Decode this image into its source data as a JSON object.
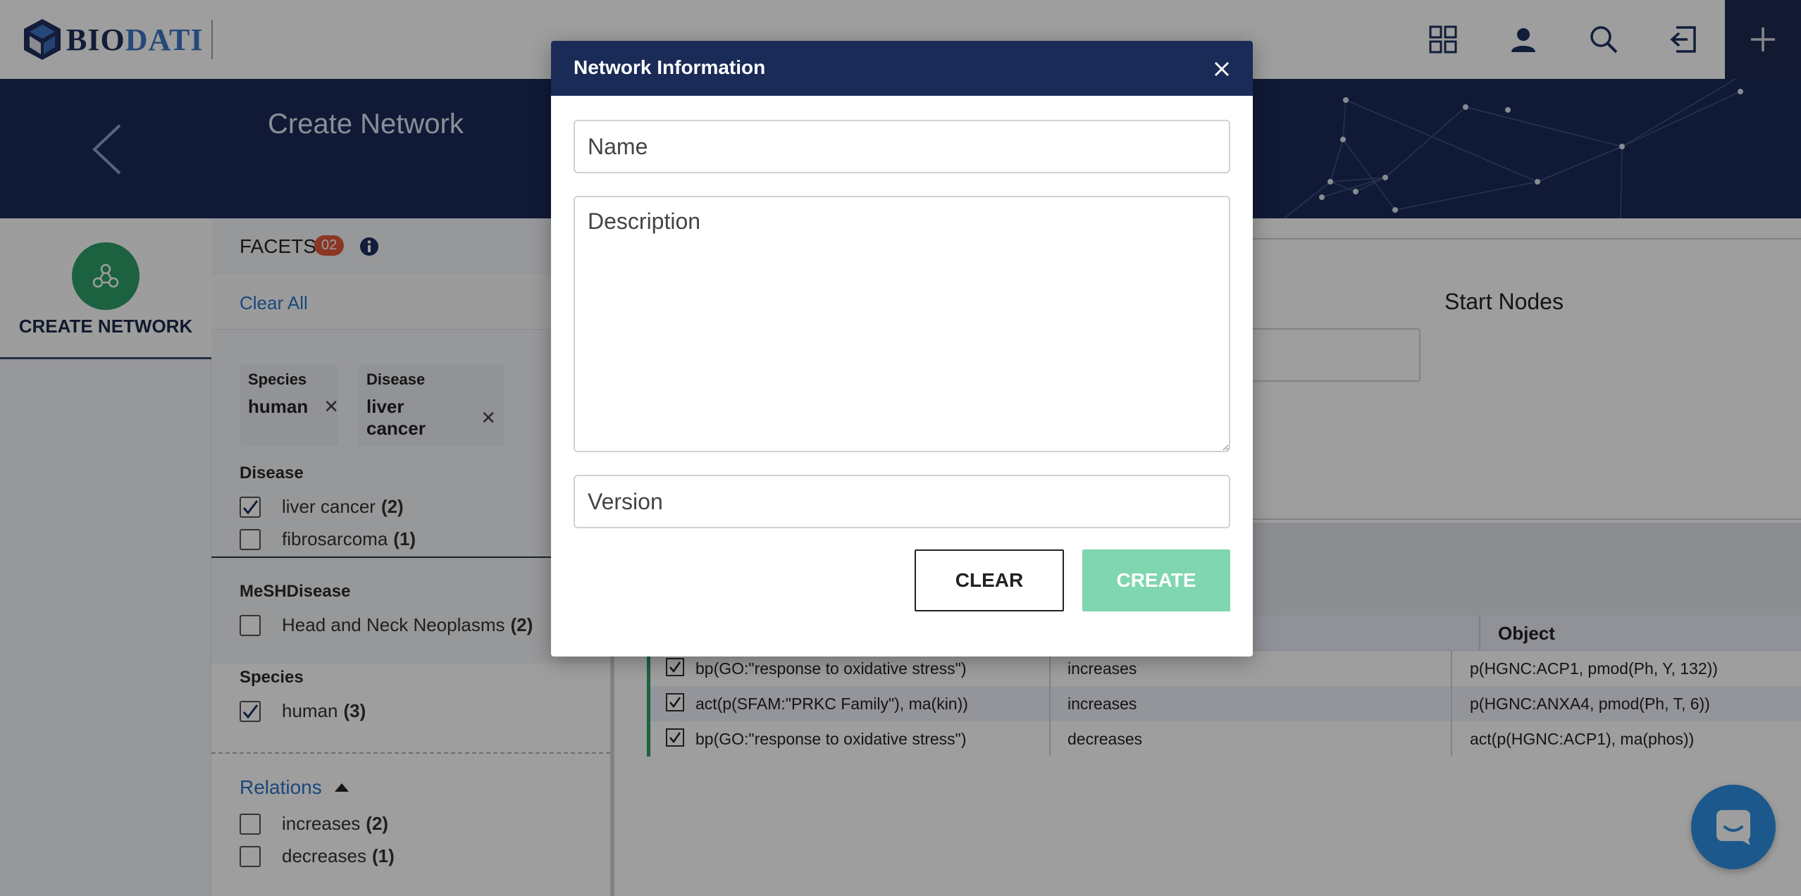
{
  "app": {
    "logo_text_1": "BIO",
    "logo_text_2": "DATI",
    "brand_colors": {
      "navy": "#1b2b57",
      "green": "#2e9d68",
      "blue": "#2a74c7"
    }
  },
  "topbar": {
    "icons": [
      "grid-icon",
      "user-icon",
      "search-icon",
      "logout-icon",
      "plus-icon"
    ]
  },
  "hero": {
    "title": "Create Network"
  },
  "leftnav": {
    "create_label": "CREATE NETWORK"
  },
  "facets": {
    "title": "FACETS",
    "badge": "02",
    "clear_all": "Clear All",
    "chips": [
      {
        "key": "Species",
        "value": "human"
      },
      {
        "key": "Disease",
        "value": "liver cancer"
      }
    ],
    "groups": [
      {
        "title": "Disease",
        "items": [
          {
            "label": "liver cancer",
            "count": "(2)",
            "checked": true
          },
          {
            "label": "fibrosarcoma",
            "count": "(1)",
            "checked": false
          }
        ]
      },
      {
        "title": "MeSHDisease",
        "items": [
          {
            "label": "Head and Neck Neoplasms",
            "count": "(2)",
            "checked": false
          }
        ]
      },
      {
        "title": "Species",
        "items": [
          {
            "label": "human",
            "count": "(3)",
            "checked": true
          }
        ]
      }
    ],
    "relations": {
      "title": "Relations",
      "items": [
        {
          "label": "increases",
          "count": "(2)",
          "checked": false
        },
        {
          "label": "decreases",
          "count": "(1)",
          "checked": false
        }
      ]
    }
  },
  "main": {
    "start_nodes_label": "Start Nodes",
    "table": {
      "object_header": "Object",
      "rows": [
        {
          "subject": "bp(GO:\"response to oxidative stress\")",
          "relation": "increases",
          "object": "p(HGNC:ACP1, pmod(Ph, Y, 132))",
          "checked": true
        },
        {
          "subject": "act(p(SFAM:\"PRKC Family\"), ma(kin))",
          "relation": "increases",
          "object": "p(HGNC:ANXA4, pmod(Ph, T, 6))",
          "checked": true
        },
        {
          "subject": "bp(GO:\"response to oxidative stress\")",
          "relation": "decreases",
          "object": "act(p(HGNC:ACP1), ma(phos))",
          "checked": true
        }
      ]
    }
  },
  "modal": {
    "title": "Network Information",
    "name_placeholder": "Name",
    "description_placeholder": "Description",
    "version_placeholder": "Version",
    "clear_label": "CLEAR",
    "create_label": "CREATE"
  }
}
